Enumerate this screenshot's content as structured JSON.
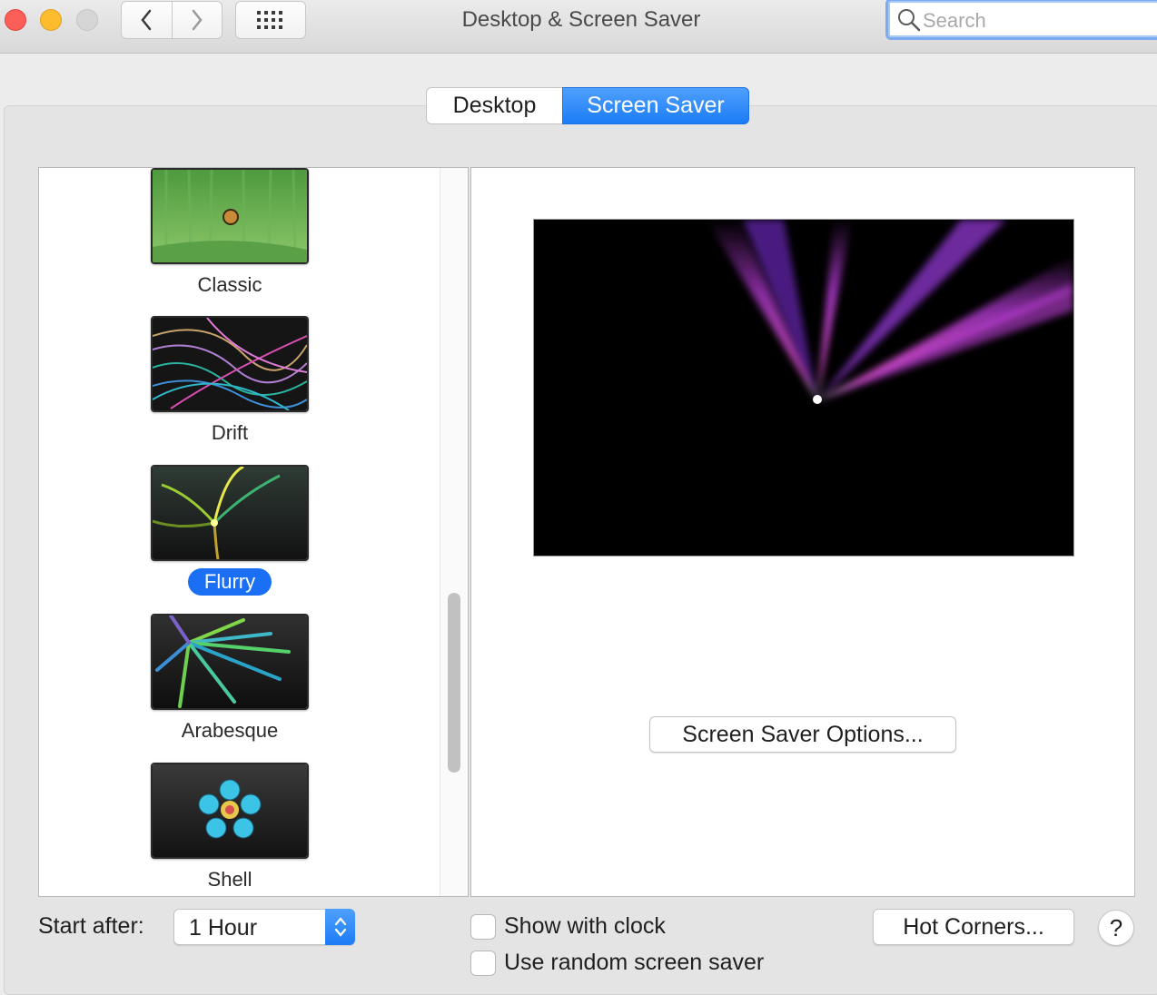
{
  "window": {
    "title": "Desktop & Screen Saver"
  },
  "toolbar": {
    "back_icon": "chevron-left-icon",
    "forward_icon": "chevron-right-icon",
    "grid_icon": "grid-icon",
    "search_placeholder": "Search"
  },
  "tabs": [
    {
      "label": "Desktop",
      "selected": false
    },
    {
      "label": "Screen Saver",
      "selected": true
    }
  ],
  "savers": [
    {
      "label": "Classic",
      "selected": false
    },
    {
      "label": "Drift",
      "selected": false
    },
    {
      "label": "Flurry",
      "selected": true
    },
    {
      "label": "Arabesque",
      "selected": false
    },
    {
      "label": "Shell",
      "selected": false
    }
  ],
  "preview": {
    "options_button": "Screen Saver Options..."
  },
  "footer": {
    "start_after_label": "Start after:",
    "start_after_value": "1 Hour",
    "show_clock_label": "Show with clock",
    "show_clock_checked": false,
    "random_label": "Use random screen saver",
    "random_checked": false,
    "hot_corners_button": "Hot Corners...",
    "help_label": "?"
  },
  "colors": {
    "accent": "#1c7cf6",
    "selected_label": "#1a6ff5"
  }
}
